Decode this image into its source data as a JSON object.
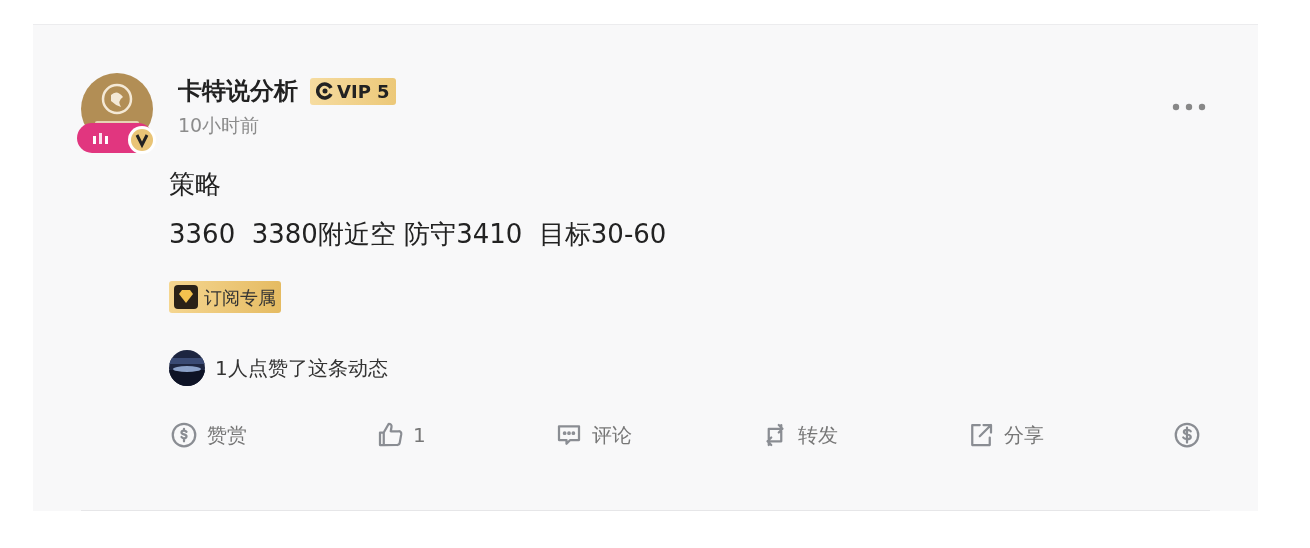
{
  "post": {
    "author": "卡特说分析",
    "vip_badge": "VIP 5",
    "time": "10小时前",
    "content_lines": [
      "策略",
      "3360  3380附近空 防守3410  目标30-60"
    ],
    "tag": "订阅专属",
    "likes_summary": "1人点赞了这条动态",
    "actions": [
      {
        "kind": "reward",
        "label": "赞赏"
      },
      {
        "kind": "like",
        "label": "1"
      },
      {
        "kind": "comment",
        "label": "评论"
      },
      {
        "kind": "repost",
        "label": "转发"
      },
      {
        "kind": "share",
        "label": "分享"
      },
      {
        "kind": "tip"
      }
    ]
  }
}
